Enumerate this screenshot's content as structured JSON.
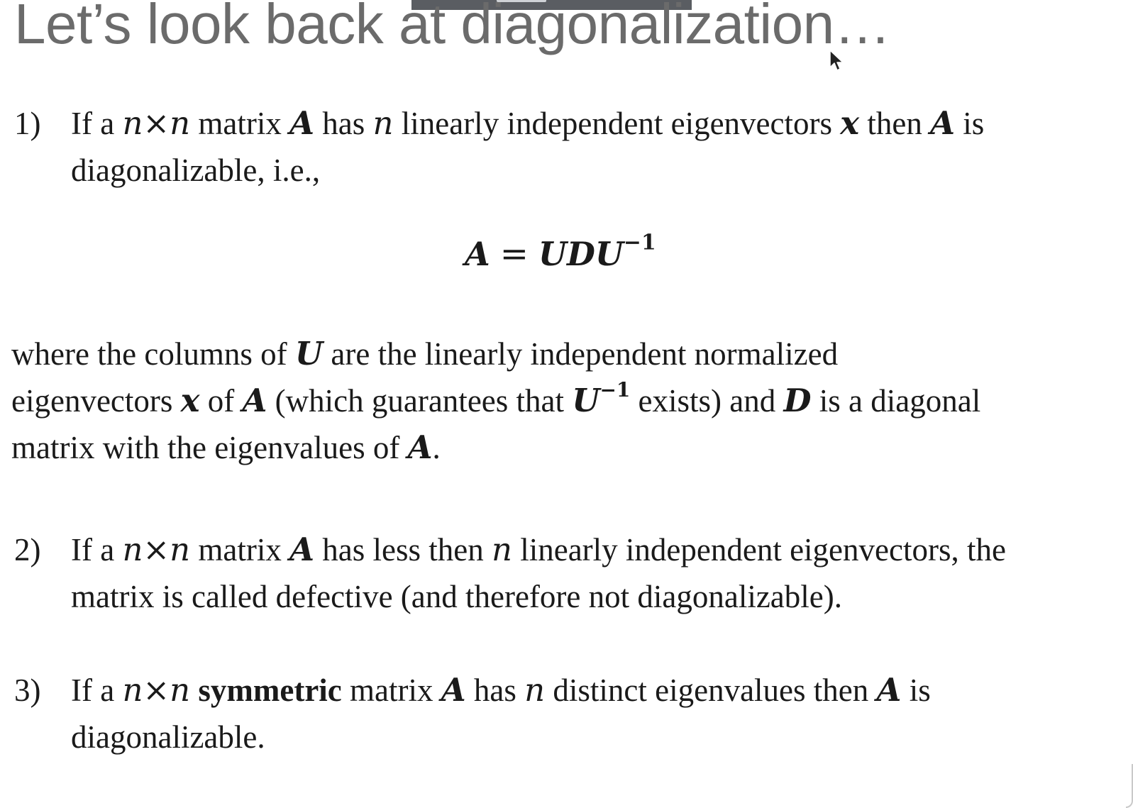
{
  "slide": {
    "title": "Let’s look back at diagonalization…"
  },
  "items": [
    {
      "number": "1)",
      "line1": [
        "If a ",
        "n×n",
        " matrix ",
        "A",
        " has ",
        "n",
        " linearly independent eigenvectors ",
        "x",
        " then ",
        "A",
        " is"
      ],
      "line2": "diagonalizable, i.e.,"
    },
    {
      "number": "2)",
      "line1": [
        "If a ",
        "n×n",
        " matrix ",
        "A",
        " has less then ",
        "n",
        " linearly independent eigenvectors, the"
      ],
      "line2": "matrix is called defective (and therefore not diagonalizable)."
    },
    {
      "number": "3)",
      "line1": [
        "If a ",
        "n×n",
        " ",
        "symmetric",
        " matrix ",
        "A",
        " has ",
        "n",
        " distinct eigenvalues then ",
        "A",
        " is"
      ],
      "line2": "diagonalizable."
    }
  ],
  "equation": {
    "lhs": "A",
    "equals": "=",
    "rhs": "UDU",
    "exponent": "−1"
  },
  "where": {
    "line1": [
      "where the columns of ",
      "U",
      " are the linearly independent normalized"
    ],
    "line2": [
      "eigenvectors ",
      "x",
      " of ",
      "A",
      "  (which guarantees that ",
      "U",
      "−1",
      " exists) and ",
      "D",
      " is a diagonal"
    ],
    "line3": [
      "matrix with the eigenvalues of ",
      "A",
      "."
    ]
  },
  "icons": {
    "cursor": "mouse-pointer-icon"
  }
}
